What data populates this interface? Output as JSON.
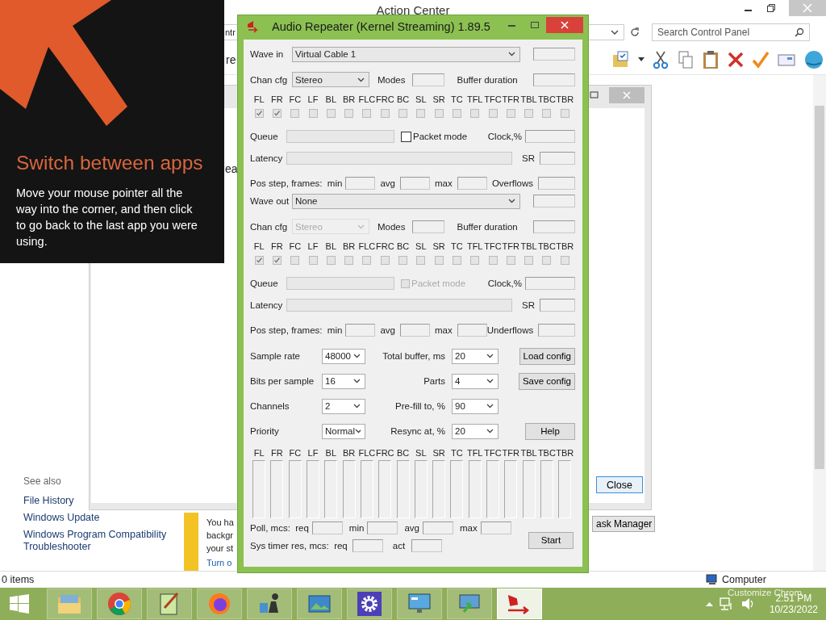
{
  "background_window": {
    "title": "Action Center",
    "address_fragment": "ntr",
    "search": {
      "placeholder": "Search Control Panel"
    },
    "fragment_top": "re",
    "fragment_mid": "ea",
    "see_also": {
      "heading": "See also",
      "links": [
        "File History",
        "Windows Update",
        "Windows Program Compatibility Troubleshooter"
      ]
    },
    "notice": {
      "lines": [
        "You ha",
        "backgr",
        "your st"
      ],
      "link": "Turn o"
    },
    "task_manager_button": "ask Manager",
    "status_bar": {
      "items": "0 items",
      "location": "Computer",
      "hint": "Customize Chrom"
    }
  },
  "behind_dialog": {
    "close_button": "Close"
  },
  "tip": {
    "title": "Switch between apps",
    "body": "Move your mouse pointer all the way into the corner, and then click to go back to the last app you were using."
  },
  "dialog": {
    "title": "Audio Repeater (Kernel Streaming) 1.89.5",
    "sections": [
      {
        "device_label": "Wave in",
        "device": "Virtual Cable 1",
        "chan_cfg_label": "Chan cfg",
        "chan_cfg": {
          "value": "Stereo",
          "disabled": false
        },
        "modes_label": "Modes",
        "buffer_label": "Buffer duration",
        "channels": [
          {
            "name": "FL",
            "checked": true
          },
          {
            "name": "FR",
            "checked": true
          },
          {
            "name": "FC",
            "checked": false
          },
          {
            "name": "LF",
            "checked": false
          },
          {
            "name": "BL",
            "checked": false
          },
          {
            "name": "BR",
            "checked": false
          },
          {
            "name": "FLC",
            "checked": false
          },
          {
            "name": "FRC",
            "checked": false
          },
          {
            "name": "BC",
            "checked": false
          },
          {
            "name": "SL",
            "checked": false
          },
          {
            "name": "SR",
            "checked": false
          },
          {
            "name": "TC",
            "checked": false
          },
          {
            "name": "TFL",
            "checked": false
          },
          {
            "name": "TFC",
            "checked": false
          },
          {
            "name": "TFR",
            "checked": false
          },
          {
            "name": "TBL",
            "checked": false
          },
          {
            "name": "TBC",
            "checked": false
          },
          {
            "name": "TBR",
            "checked": false
          }
        ],
        "queue_label": "Queue",
        "packet_mode": {
          "label": "Packet mode",
          "checked": false,
          "disabled": false
        },
        "clock_label": "Clock,%",
        "latency_label": "Latency",
        "sr_label": "SR",
        "pos_label": "Pos step, frames:  min",
        "avg_label": "avg",
        "max_label": "max",
        "counter_label": "Overflows"
      },
      {
        "device_label": "Wave out",
        "device": "None",
        "chan_cfg_label": "Chan cfg",
        "chan_cfg": {
          "value": "Stereo",
          "disabled": true
        },
        "modes_label": "Modes",
        "buffer_label": "Buffer duration",
        "channels": [
          {
            "name": "FL",
            "checked": true
          },
          {
            "name": "FR",
            "checked": true
          },
          {
            "name": "FC",
            "checked": false
          },
          {
            "name": "LF",
            "checked": false
          },
          {
            "name": "BL",
            "checked": false
          },
          {
            "name": "BR",
            "checked": false
          },
          {
            "name": "FLC",
            "checked": false
          },
          {
            "name": "FRC",
            "checked": false
          },
          {
            "name": "BC",
            "checked": false
          },
          {
            "name": "SL",
            "checked": false
          },
          {
            "name": "SR",
            "checked": false
          },
          {
            "name": "TC",
            "checked": false
          },
          {
            "name": "TFL",
            "checked": false
          },
          {
            "name": "TFC",
            "checked": false
          },
          {
            "name": "TFR",
            "checked": false
          },
          {
            "name": "TBL",
            "checked": false
          },
          {
            "name": "TBC",
            "checked": false
          },
          {
            "name": "TBR",
            "checked": false
          }
        ],
        "queue_label": "Queue",
        "packet_mode": {
          "label": "Packet mode",
          "checked": false,
          "disabled": true
        },
        "clock_label": "Clock,%",
        "latency_label": "Latency",
        "sr_label": "SR",
        "pos_label": "Pos step, frames:  min",
        "avg_label": "avg",
        "max_label": "max",
        "counter_label": "Underflows"
      }
    ],
    "settings": [
      {
        "label": "Sample rate",
        "value": "48000",
        "label2": "Total buffer, ms",
        "value2": "20",
        "button": "Load config"
      },
      {
        "label": "Bits per sample",
        "value": "16",
        "label2": "Parts",
        "value2": "4",
        "button": "Save config"
      },
      {
        "label": "Channels",
        "value": "2",
        "label2": "Pre-fill to, %",
        "value2": "90"
      },
      {
        "label": "Priority",
        "value": "Normal",
        "label2": "Resync at, %",
        "value2": "20",
        "button": "Help"
      }
    ],
    "meters": [
      {
        "name": "FL",
        "level": 0
      },
      {
        "name": "FR",
        "level": 0
      },
      {
        "name": "FC",
        "level": 0
      },
      {
        "name": "LF",
        "level": 0
      },
      {
        "name": "BL",
        "level": 0
      },
      {
        "name": "BR",
        "level": 0
      },
      {
        "name": "FLC",
        "level": 0
      },
      {
        "name": "FRC",
        "level": 0
      },
      {
        "name": "BC",
        "level": 0
      },
      {
        "name": "SL",
        "level": 0
      },
      {
        "name": "SR",
        "level": 0
      },
      {
        "name": "TC",
        "level": 0
      },
      {
        "name": "TFL",
        "level": 0
      },
      {
        "name": "TFC",
        "level": 0
      },
      {
        "name": "TFR",
        "level": 0
      },
      {
        "name": "TBL",
        "level": 0
      },
      {
        "name": "TBC",
        "level": 0
      },
      {
        "name": "TBR",
        "level": 0
      }
    ],
    "poll": {
      "label": "Poll, mcs:  req",
      "min_label": "min",
      "avg_label": "avg",
      "max_label": "max"
    },
    "timer": {
      "label": "Sys timer res, mcs:  req",
      "act_label": "act"
    },
    "start_button": "Start"
  },
  "taskbar": {
    "apps": [
      {
        "kind": "folder",
        "selected": false
      },
      {
        "kind": "browser",
        "selected": false
      },
      {
        "kind": "editor",
        "selected": false
      },
      {
        "kind": "fox",
        "selected": false
      },
      {
        "kind": "chess",
        "selected": false
      },
      {
        "kind": "picture",
        "selected": false
      },
      {
        "kind": "gear",
        "selected": false
      },
      {
        "kind": "panel",
        "selected": false
      },
      {
        "kind": "remote",
        "selected": false
      },
      {
        "kind": "speaker",
        "selected": true
      }
    ],
    "time": "2:51 PM",
    "date": "10/23/2022"
  }
}
